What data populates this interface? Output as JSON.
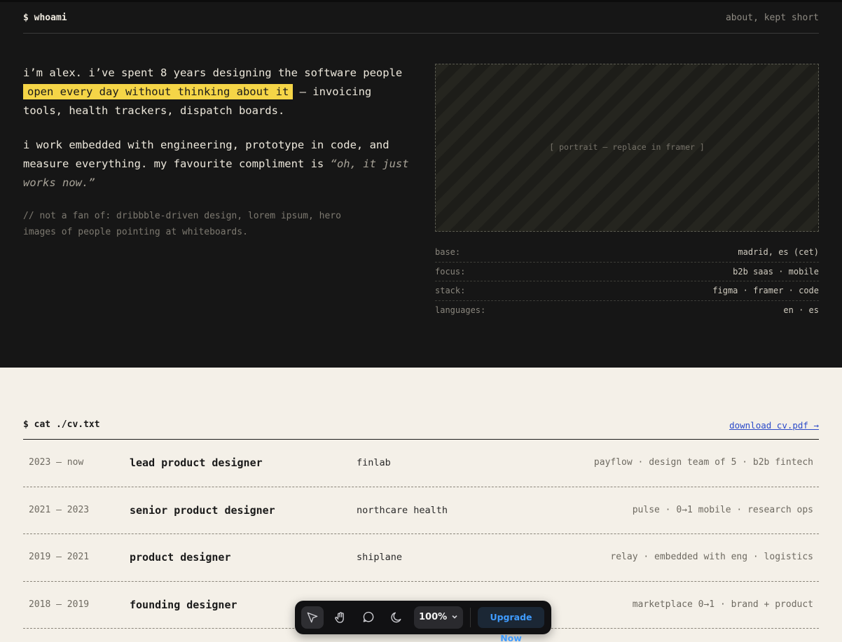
{
  "header": {
    "prompt": "$ whoami",
    "tagline": "about, kept short"
  },
  "intro": {
    "p1_before": "i’m alex. i’ve spent 8 years designing the software people ",
    "p1_highlight": "open every day without thinking about it",
    "p1_after": " — invoicing tools, health trackers, dispatch boards.",
    "p2_before": "i work embedded with engineering, prototype in code, and measure everything. my favourite compliment is ",
    "p2_quote": "“oh, it just works now.”",
    "aside": "// not a fan of: dribbble-driven design, lorem ipsum, hero images of people pointing at whiteboards."
  },
  "portrait": {
    "placeholder": "[ portrait — replace in framer ]"
  },
  "facts": [
    {
      "key": "base:",
      "value": "madrid, es (cet)"
    },
    {
      "key": "focus:",
      "value": "b2b saas · mobile"
    },
    {
      "key": "stack:",
      "value": "figma · framer · code"
    },
    {
      "key": "languages:",
      "value": "en · es"
    }
  ],
  "cv": {
    "command": "$ cat ./cv.txt",
    "download_label": "download cv.pdf →",
    "rows": [
      {
        "years": "2023 — now",
        "role": "lead product designer",
        "company": "finlab",
        "details": "payflow · design team of 5 · b2b fintech"
      },
      {
        "years": "2021 — 2023",
        "role": "senior product designer",
        "company": "northcare health",
        "details": "pulse · 0→1 mobile · research ops"
      },
      {
        "years": "2019 — 2021",
        "role": "product designer",
        "company": "shiplane",
        "details": "relay · embedded with eng · logistics"
      },
      {
        "years": "2018 — 2019",
        "role": "founding designer",
        "company": "",
        "details": "marketplace 0→1 · brand + product"
      }
    ]
  },
  "toolbar": {
    "icons": [
      "cursor-icon",
      "hand-icon",
      "comment-icon",
      "moon-icon"
    ],
    "zoom": "100%",
    "upgrade_label": "Upgrade Now",
    "accent": "#3f9bff"
  }
}
